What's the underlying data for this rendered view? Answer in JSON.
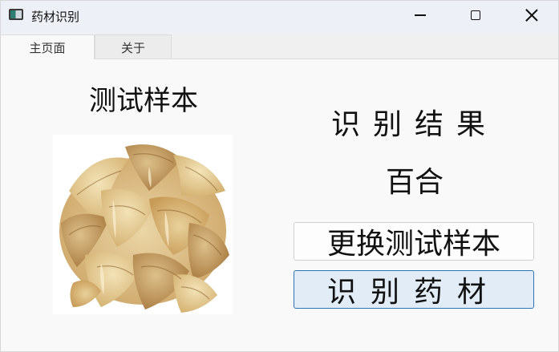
{
  "window": {
    "title": "药材识别",
    "app_icon": "app-window-icon",
    "controls": {
      "minimize_icon": "minimize-icon",
      "maximize_icon": "maximize-icon",
      "close_icon": "close-icon"
    }
  },
  "tabs": [
    {
      "label": "主页面",
      "selected": true
    },
    {
      "label": "关于",
      "selected": false
    }
  ],
  "main": {
    "sample_title": "测试样本",
    "sample_image": "dried lily bulb scales",
    "result_title": "识别结果",
    "result_value": "百合",
    "change_sample_label": "更换测试样本",
    "identify_label": "识别药材"
  },
  "colors": {
    "titlebar_bg": "#eef0f8",
    "identify_button_bg": "#e1ecf7",
    "identify_button_border": "#2e72b8"
  }
}
